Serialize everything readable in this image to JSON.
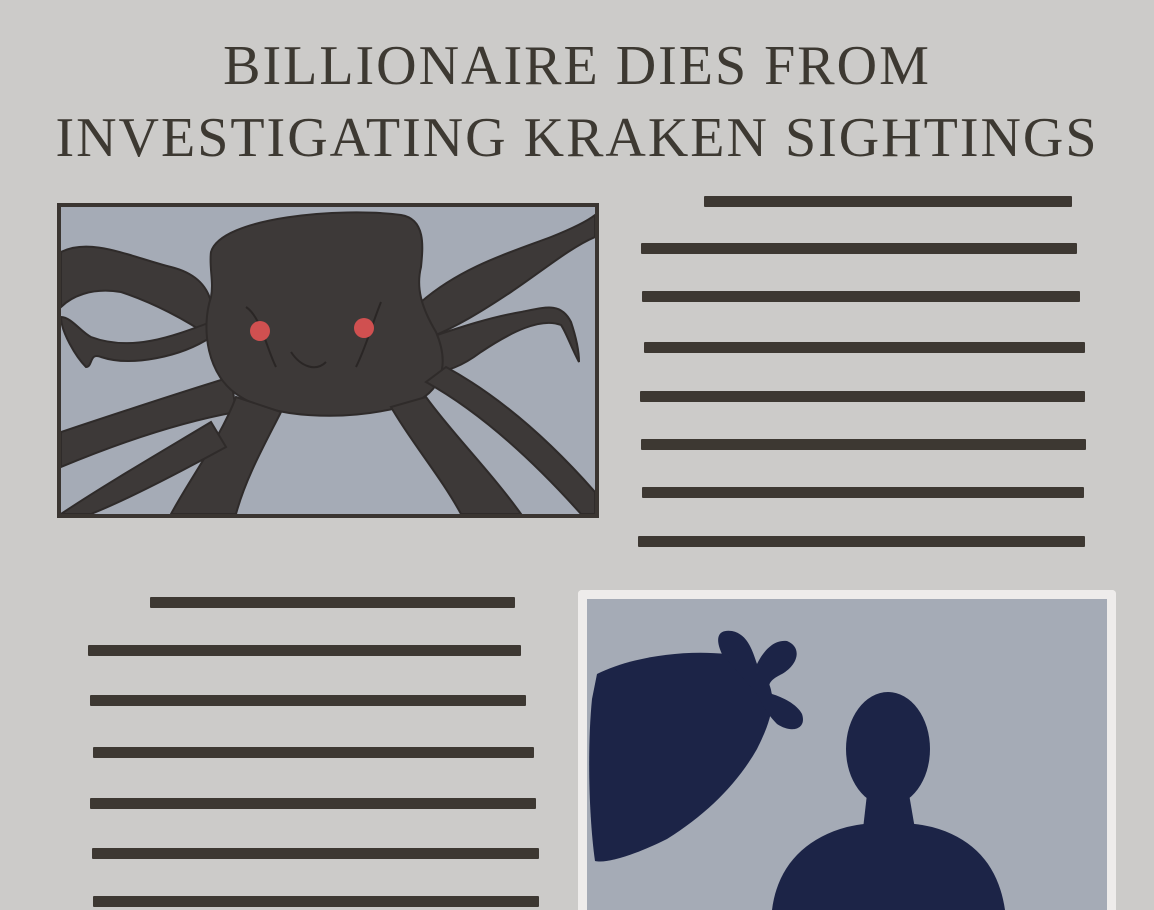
{
  "headline": {
    "line1": "BILLIONAIRE DIES FROM",
    "line2": "INVESTIGATING KRAKEN SIGHTINGS"
  },
  "colors": {
    "background": "#cccbc9",
    "ink": "#3d3832",
    "photo_sky": "#a5abb6",
    "kraken_body": "#3d3938",
    "kraken_eyes": "#d05050",
    "silhouette": "#1c2447",
    "photo_border": "#eeeceb"
  },
  "images": {
    "kraken_photo": "kraken-illustration",
    "person_photo": "person-with-bag-silhouette"
  }
}
